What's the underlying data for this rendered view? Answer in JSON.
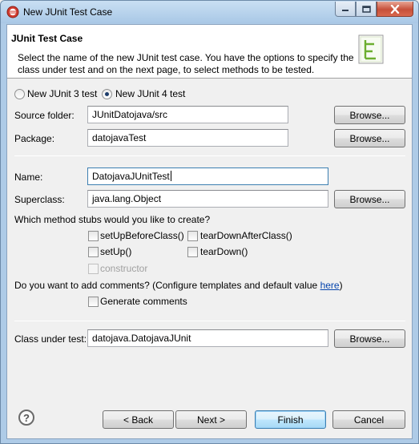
{
  "window": {
    "title": "New JUnit Test Case",
    "app_icon": "eclipse-icon",
    "controls": {
      "minimize_icon": "minimize-icon",
      "maximize_icon": "maximize-icon",
      "close_icon": "close-icon"
    }
  },
  "banner": {
    "title": "JUnit Test Case",
    "description": "Select the name of the new JUnit test case. You have the options to specify the class under test and on the next page, to select methods to be tested.",
    "icon": "junit-wizard-icon"
  },
  "version": {
    "options": [
      {
        "label": "New JUnit 3 test",
        "selected": false
      },
      {
        "label": "New JUnit 4 test",
        "selected": true
      }
    ]
  },
  "source_folder": {
    "label": "Source folder:",
    "value": "JUnitDatojava/src",
    "browse": "Browse..."
  },
  "package": {
    "label": "Package:",
    "value": "datojavaTest",
    "browse": "Browse..."
  },
  "name": {
    "label": "Name:",
    "value": "DatojavaJUnitTest"
  },
  "superclass": {
    "label": "Superclass:",
    "value": "java.lang.Object",
    "browse": "Browse..."
  },
  "stubs": {
    "question": "Which method stubs would you like to create?",
    "setUpBeforeClass": "setUpBeforeClass()",
    "tearDownAfterClass": "tearDownAfterClass()",
    "setUp": "setUp()",
    "tearDown": "tearDown()",
    "constructor": "constructor"
  },
  "comments": {
    "question": "Do you want to add comments? (Configure templates and default value ",
    "link": "here",
    "close": ")",
    "generate": "Generate comments"
  },
  "class_under_test": {
    "label": "Class under test:",
    "value": "datojava.DatojavaJUnit",
    "browse": "Browse..."
  },
  "footer": {
    "help_glyph": "?",
    "back": "< Back",
    "next": "Next >",
    "finish": "Finish",
    "cancel": "Cancel"
  },
  "colors": {
    "accent": "#3c7fb1",
    "link": "#0645ad",
    "frame": "#aecbe7"
  }
}
